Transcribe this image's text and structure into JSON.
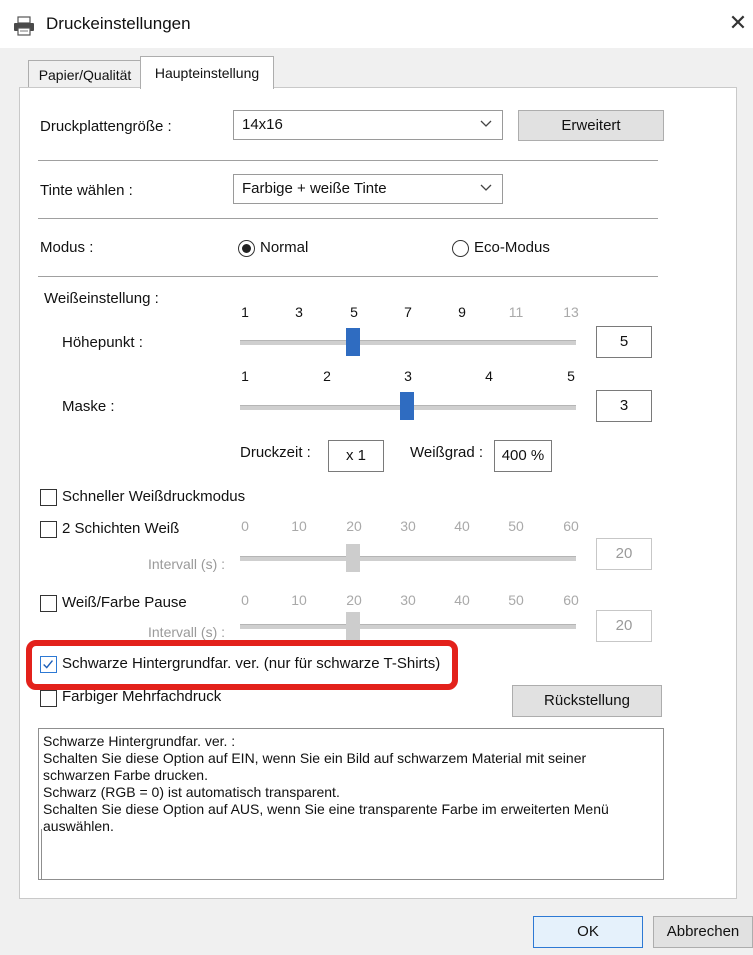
{
  "window": {
    "title": "Druckeinstellungen",
    "close_icon": "close-icon",
    "app_icon": "printer-icon"
  },
  "tabs": [
    {
      "label": "Papier/Qualität",
      "active": false
    },
    {
      "label": "Haupteinstellung",
      "active": true
    }
  ],
  "platen": {
    "label": "Druckplattengröße :",
    "value": "14x16",
    "button": "Erweitert"
  },
  "ink": {
    "label": "Tinte wählen :",
    "value": "Farbige + weiße Tinte"
  },
  "mode": {
    "label": "Modus :",
    "options": [
      "Normal",
      "Eco-Modus"
    ],
    "selected": "Normal"
  },
  "white": {
    "label": "Weißeinstellung :",
    "highlight": {
      "label": "Höhepunkt :",
      "ticks": [
        "1",
        "3",
        "5",
        "7",
        "9",
        "11",
        "13"
      ],
      "value": "5",
      "range": [
        1,
        13
      ]
    },
    "mask": {
      "label": "Maske :",
      "ticks": [
        "1",
        "2",
        "3",
        "4",
        "5"
      ],
      "value": "3",
      "range": [
        1,
        5
      ]
    },
    "print_time": {
      "label": "Druckzeit :",
      "value": "x 1"
    },
    "white_degree": {
      "label": "Weißgrad :",
      "value": "400 %"
    }
  },
  "fast_white": {
    "label": "Schneller Weißdruckmodus",
    "checked": false
  },
  "two_layers": {
    "label": "2 Schichten Weiß",
    "checked": false,
    "ticks": [
      "0",
      "10",
      "20",
      "30",
      "40",
      "50",
      "60"
    ],
    "interval_label": "Intervall (s) :",
    "value": "20",
    "range": [
      0,
      60
    ]
  },
  "white_color_pause": {
    "label": "Weiß/Farbe Pause",
    "checked": false,
    "ticks": [
      "0",
      "10",
      "20",
      "30",
      "40",
      "50",
      "60"
    ],
    "interval_label": "Intervall (s) :",
    "value": "20",
    "range": [
      0,
      60
    ]
  },
  "black_bg": {
    "label": "Schwarze Hintergrundfar. ver. (nur für schwarze T-Shirts)",
    "checked": true
  },
  "color_multi": {
    "label": "Farbiger Mehrfachdruck",
    "checked": false
  },
  "reset_button": "Rückstellung",
  "description": "Schwarze Hintergrundfar. ver. :\nSchalten Sie diese Option auf EIN, wenn Sie ein Bild auf schwarzem Material mit seiner\nschwarzen Farbe drucken.\nSchwarz (RGB = 0) ist automatisch transparent.\nSchalten Sie diese Option auf AUS, wenn Sie eine transparente Farbe im erweiterten Menü\nauswählen.",
  "footer": {
    "ok": "OK",
    "cancel": "Abbrechen"
  },
  "colors": {
    "accent": "#2f6cc1",
    "highlight_box": "#e3211b"
  }
}
